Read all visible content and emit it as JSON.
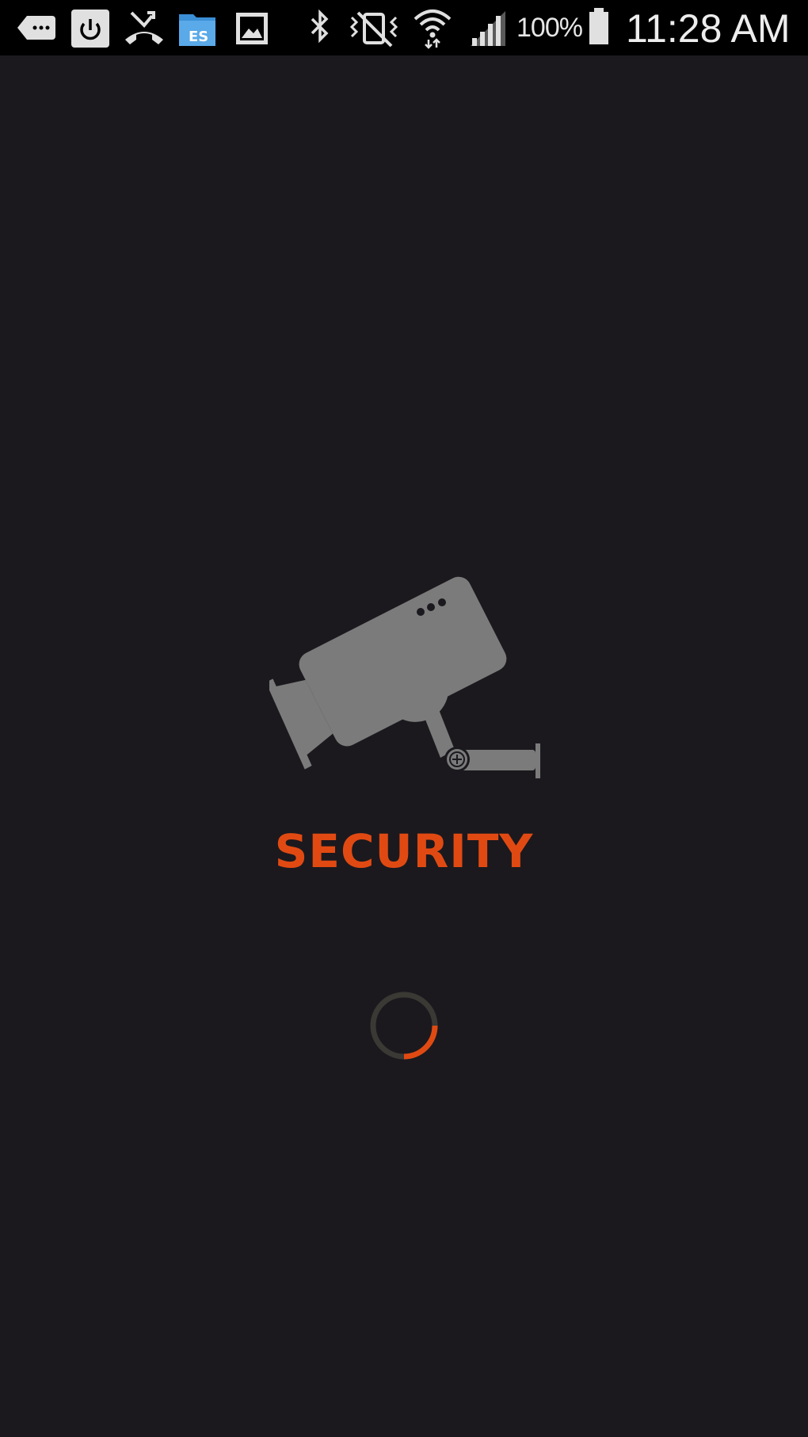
{
  "status_bar": {
    "battery_percent": "100%",
    "time": "11:28 AM",
    "icons": [
      "messages-icon",
      "power-icon",
      "missed-call-icon",
      "es-file-explorer-icon",
      "gallery-icon",
      "bluetooth-icon",
      "vibrate-icon",
      "wifi-icon",
      "signal-icon",
      "battery-icon"
    ]
  },
  "splash": {
    "title": "SECURITY",
    "camera_icon": "security-camera-icon",
    "loading_icon": "loading-spinner-icon"
  },
  "colors": {
    "background": "#1b191e",
    "accent": "#e04a12",
    "icon_gray": "#7b7b7b",
    "status_bar": "#000000"
  }
}
